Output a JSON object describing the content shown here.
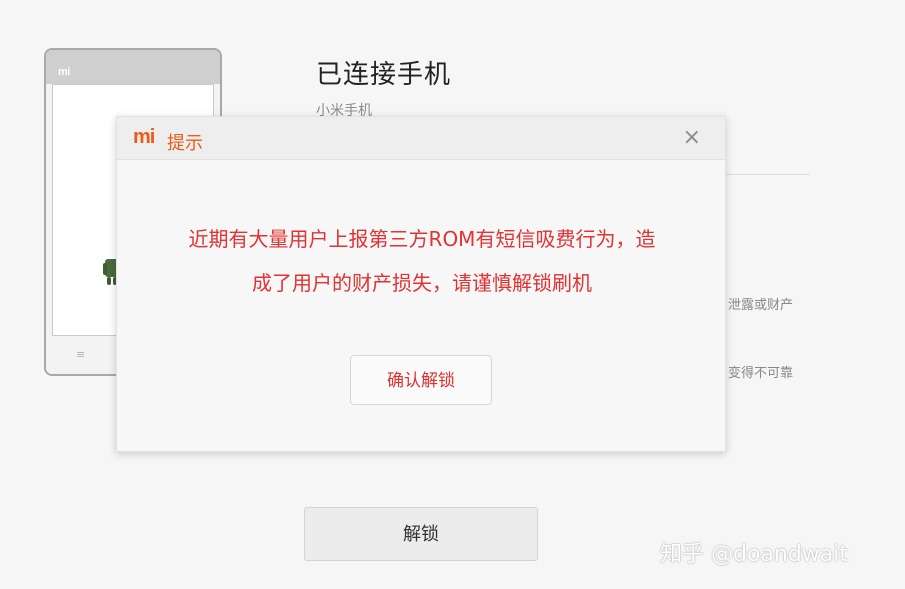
{
  "phone": {
    "logo": "mi",
    "menu_glyph": "≡"
  },
  "device": {
    "title": "已连接手机",
    "subtitle": "小米手机",
    "side_text_1": "泄露或财产",
    "side_text_2": "变得不可靠"
  },
  "dialog": {
    "logo": "mi",
    "title": "提示",
    "close_glyph": "×",
    "message": "近期有大量用户上报第三方ROM有短信吸费行为，造成了用户的财产损失，请谨慎解锁刷机",
    "confirm_label": "确认解锁"
  },
  "unlock_label": "解锁",
  "watermark": "知乎 @doandwait",
  "colors": {
    "brand_orange": "#ee5b16",
    "warning_red": "#e23232"
  }
}
